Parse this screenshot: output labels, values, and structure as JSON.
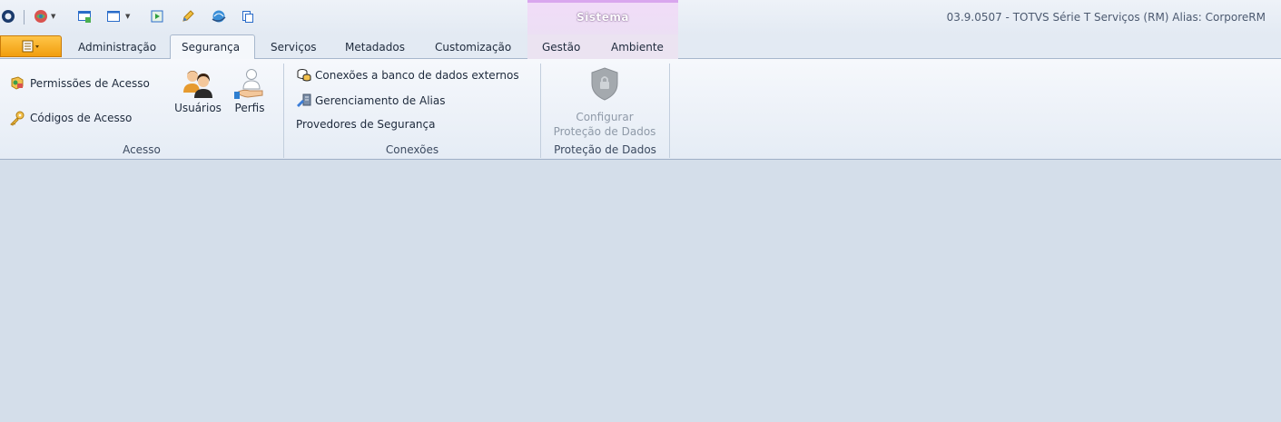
{
  "titlebar": {
    "app_title": "03.9.0507 - TOTVS Série T Serviços (RM) Alias: CorporeRM",
    "context_group_title": "Sistema"
  },
  "quick_access": {
    "icons": [
      "app-logo-icon",
      "globe-icon",
      "window-icon",
      "layout-icon",
      "export-icon",
      "pencil-icon",
      "web-icon",
      "copy-icon"
    ]
  },
  "tabs": {
    "administracao": "Administração",
    "seguranca": "Segurança",
    "servicos": "Serviços",
    "metadados": "Metadados",
    "customizacao": "Customização",
    "gestao": "Gestão",
    "ambiente": "Ambiente"
  },
  "ribbon": {
    "acesso": {
      "label": "Acesso",
      "permissoes": "Permissões de Acesso",
      "codigos": "Códigos de Acesso",
      "usuarios": "Usuários",
      "perfis": "Perfis"
    },
    "conexoes": {
      "label": "Conexões",
      "externos": "Conexões a banco de dados externos",
      "alias": "Gerenciamento de Alias",
      "provedores": "Provedores de Segurança"
    },
    "protecao": {
      "label": "Proteção de Dados",
      "configurar_line1": "Configurar",
      "configurar_line2": "Proteção de Dados"
    }
  },
  "colors": {
    "file_button": "#f5a623",
    "context_group": "#d9a6ee",
    "workspace": "#d4deea"
  }
}
